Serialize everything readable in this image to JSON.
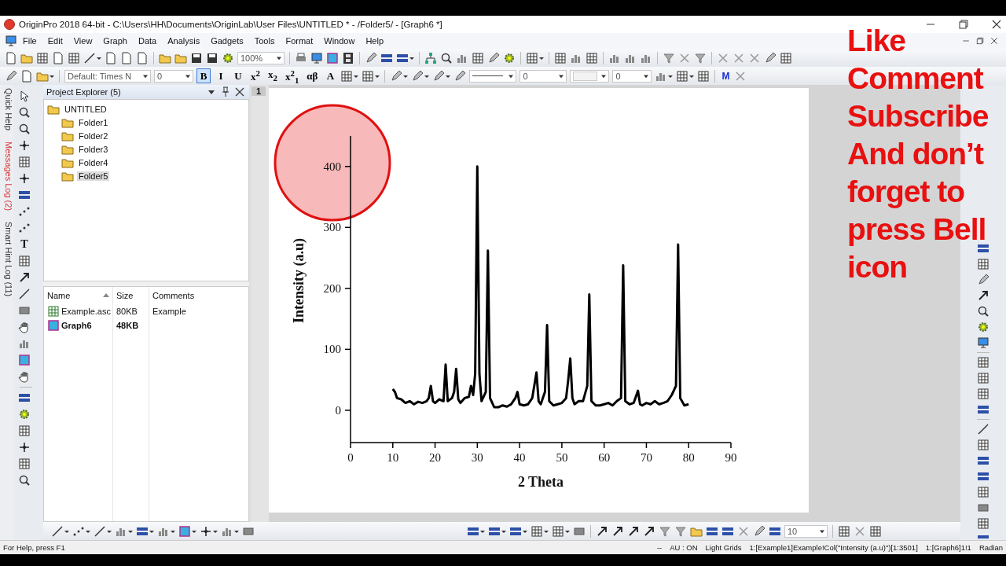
{
  "window": {
    "title": "OriginPro 2018 64-bit - C:\\Users\\HH\\Documents\\OriginLab\\User Files\\UNTITLED * - /Folder5/ - [Graph6 *]"
  },
  "menu": [
    "File",
    "Edit",
    "View",
    "Graph",
    "Data",
    "Analysis",
    "Gadgets",
    "Tools",
    "Format",
    "Window",
    "Help"
  ],
  "standard_toolbar": {
    "zoom": "100%"
  },
  "format_toolbar": {
    "font": "Default: Times N",
    "size": "0",
    "buttons": [
      {
        "label": "B",
        "selected": true
      },
      {
        "label": "I",
        "selected": false
      },
      {
        "label": "U",
        "selected": false
      },
      {
        "label": "x$^{2}$",
        "selected": false
      },
      {
        "label": "x$_{2}$",
        "selected": false
      },
      {
        "label": "x$^{2}$$_{1}$",
        "selected": false
      },
      {
        "label": "αβ",
        "selected": false
      },
      {
        "label": "A",
        "selected": false
      }
    ]
  },
  "style_toolbar": {
    "fields": [
      "0",
      "0"
    ],
    "mask_button": "M"
  },
  "side_tabs": [
    {
      "label": "Quick Help",
      "highlighted": false
    },
    {
      "label": "Messages Log (2)",
      "highlighted": true
    },
    {
      "label": "Smart Hint Log (11)",
      "highlighted": false
    }
  ],
  "tools_toolbar": {
    "text_tool": "T"
  },
  "project_explorer": {
    "title": "Project Explorer (5)",
    "tree": {
      "label": "UNTITLED",
      "selected": false,
      "children": [
        {
          "label": "Folder1",
          "selected": false
        },
        {
          "label": "Folder2",
          "selected": false
        },
        {
          "label": "Folder3",
          "selected": false
        },
        {
          "label": "Folder4",
          "selected": false
        },
        {
          "label": "Folder5",
          "selected": true
        }
      ]
    },
    "columns": [
      "Name",
      "Size",
      "Comments"
    ],
    "rows": [
      {
        "kind": "workbook",
        "name": "Example.asc",
        "size": "80KB",
        "comments": "Example",
        "current": false
      },
      {
        "kind": "graph",
        "name": "Graph6",
        "size": "48KB",
        "current": true
      }
    ]
  },
  "graph": {
    "page_tab": "1",
    "chart_data": {
      "type": "line",
      "xlabel": "2 Theta",
      "ylabel": "Intensity (a.u)",
      "xlim": [
        0,
        90
      ],
      "ylim": [
        -53,
        450
      ],
      "xticks": [
        0,
        10,
        20,
        30,
        40,
        50,
        60,
        70,
        80,
        90
      ],
      "yticks": [
        0,
        100,
        200,
        300,
        400
      ],
      "x": [
        10,
        10.5,
        11,
        12,
        13,
        14,
        15,
        16,
        17,
        18,
        18.5,
        19,
        19.5,
        20,
        21,
        22,
        22.5,
        23,
        24,
        24.5,
        25,
        25.5,
        26,
        27,
        28,
        28.5,
        29,
        29.5,
        30,
        30.5,
        31,
        32,
        32.5,
        33,
        34,
        35,
        36,
        37,
        38,
        39,
        39.5,
        40,
        41,
        42,
        43,
        44,
        44.5,
        45,
        46,
        46.5,
        47,
        48,
        49,
        50,
        51,
        51.5,
        52,
        52.5,
        53,
        54,
        55,
        56,
        56.5,
        57,
        58,
        59,
        60,
        61,
        62,
        63,
        64,
        64.5,
        65,
        66,
        67,
        68,
        68.5,
        69,
        70,
        71,
        72,
        73,
        74,
        75,
        76,
        77,
        77.5,
        78,
        79,
        80
      ],
      "series": [
        {
          "color": "#000000",
          "values": [
            35,
            30,
            20,
            18,
            12,
            15,
            10,
            14,
            12,
            15,
            20,
            40,
            15,
            12,
            18,
            15,
            75,
            15,
            20,
            30,
            68,
            18,
            12,
            20,
            22,
            40,
            25,
            60,
            400,
            60,
            15,
            30,
            262,
            20,
            5,
            5,
            8,
            6,
            10,
            20,
            30,
            10,
            8,
            10,
            20,
            62,
            15,
            10,
            30,
            140,
            15,
            8,
            10,
            12,
            20,
            50,
            85,
            20,
            10,
            15,
            15,
            40,
            190,
            15,
            8,
            8,
            10,
            12,
            8,
            15,
            20,
            238,
            15,
            10,
            12,
            32,
            10,
            8,
            12,
            10,
            15,
            10,
            12,
            15,
            25,
            40,
            272,
            20,
            8,
            10
          ]
        }
      ]
    }
  },
  "bottom_toolbar": {
    "field": "10"
  },
  "overlay_caption": [
    "Like",
    "Comment",
    "Subscribe",
    "And don’t",
    "forget to",
    "press Bell",
    "icon"
  ],
  "status_bar": {
    "help": "For Help, press F1",
    "items": [
      "--",
      "AU : ON",
      "Light Grids",
      "1:[Example1]Example!Col(\"Intensity (a.u)\")[1:3501]",
      "1:[Graph6]1!1",
      "Radian"
    ]
  }
}
